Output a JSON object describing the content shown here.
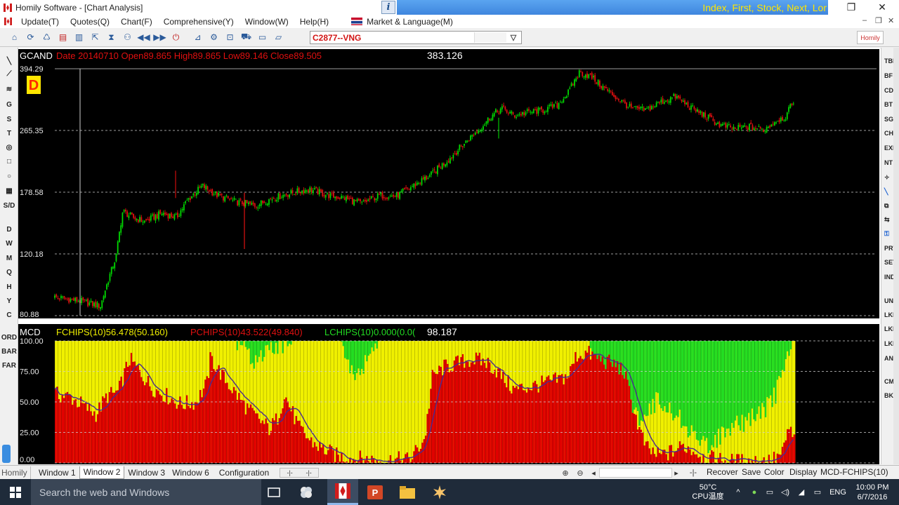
{
  "window": {
    "title": "Homily Software - [Chart Analysis]",
    "ticker_text": "Index, First, Stock, Next, Lor",
    "info_button": "i"
  },
  "menu": {
    "items": [
      "Update(T)",
      "Quotes(Q)",
      "Chart(F)",
      "Comprehensive(Y)",
      "Window(W)",
      "Help(H)"
    ],
    "market_language": "Market & Language(M)"
  },
  "toolbar": {
    "symbol": "C2877--VNG",
    "right_label": "Homily"
  },
  "left_tools": [
    "G",
    "S",
    "T",
    "S/D",
    "D",
    "W",
    "M",
    "Q",
    "H",
    "Y",
    "C",
    "ORD",
    "BAR",
    "FAR"
  ],
  "right_tools": [
    "TBF",
    "BF",
    "CD",
    "BT",
    "SGN",
    "CHN",
    "EXP",
    "NT",
    "PRT",
    "SET",
    "IND",
    "UNI",
    "LKL",
    "LKP",
    "LKM",
    "ANZ",
    "CM",
    "BK"
  ],
  "main_chart": {
    "code": "GCAND",
    "period_badge": "D",
    "info_line": "Date 20140710   Open89.865   High89.865   Low89.146   Close89.505",
    "cursor_value": "383.126"
  },
  "indicator": {
    "code": "MCD",
    "fchips": "FCHIPS(10)56.478(50.160)",
    "pchips": "PCHIPS(10)43.522(49.840)",
    "lchips": "LCHIPS(10)0.000(0.0(",
    "cursor_value": "98.187"
  },
  "chart_data": [
    {
      "type": "candlestick",
      "name": "GCAND",
      "y_ticks": [
        394.29,
        265.35,
        178.58,
        120.18,
        80.88
      ],
      "ylim": [
        80.88,
        394.29
      ],
      "log_scale": true,
      "grid": "dashed horizontal at tick levels",
      "colors": {
        "up": "#00d800",
        "down": "#e01010",
        "cursor": "#cfcfcf",
        "background": "#000000"
      },
      "close_trend": [
        [
          0.0,
          91
        ],
        [
          0.032,
          89
        ],
        [
          0.062,
          86
        ],
        [
          0.07,
          98
        ],
        [
          0.083,
          118
        ],
        [
          0.092,
          158
        ],
        [
          0.105,
          152
        ],
        [
          0.122,
          148
        ],
        [
          0.145,
          156
        ],
        [
          0.165,
          152
        ],
        [
          0.18,
          170
        ],
        [
          0.2,
          186
        ],
        [
          0.22,
          175
        ],
        [
          0.245,
          168
        ],
        [
          0.272,
          164
        ],
        [
          0.295,
          172
        ],
        [
          0.322,
          178
        ],
        [
          0.345,
          182
        ],
        [
          0.37,
          175
        ],
        [
          0.392,
          172
        ],
        [
          0.415,
          166
        ],
        [
          0.44,
          175
        ],
        [
          0.462,
          174
        ],
        [
          0.485,
          186
        ],
        [
          0.51,
          200
        ],
        [
          0.535,
          222
        ],
        [
          0.555,
          245
        ],
        [
          0.575,
          268
        ],
        [
          0.59,
          290
        ],
        [
          0.605,
          306
        ],
        [
          0.622,
          292
        ],
        [
          0.64,
          298
        ],
        [
          0.66,
          302
        ],
        [
          0.68,
          312
        ],
        [
          0.695,
          338
        ],
        [
          0.71,
          385
        ],
        [
          0.725,
          376
        ],
        [
          0.742,
          350
        ],
        [
          0.76,
          328
        ],
        [
          0.78,
          306
        ],
        [
          0.8,
          302
        ],
        [
          0.82,
          318
        ],
        [
          0.84,
          330
        ],
        [
          0.86,
          308
        ],
        [
          0.88,
          292
        ],
        [
          0.9,
          275
        ],
        [
          0.92,
          268
        ],
        [
          0.94,
          272
        ],
        [
          0.96,
          266
        ],
        [
          0.975,
          282
        ],
        [
          0.99,
          290
        ],
        [
          1.0,
          322
        ]
      ]
    },
    {
      "type": "stacked-area",
      "name": "MCD",
      "y_ticks": [
        100.0,
        75.0,
        50.0,
        25.0,
        0.0
      ],
      "ylim": [
        0,
        100
      ],
      "grid": "dashed horizontal at tick levels",
      "colors": {
        "FCHIPS": "#f0f000",
        "PCHIPS": "#e00000",
        "LCHIPS": "#22dd22",
        "average_line": "#4a2a90",
        "background": "#000000"
      },
      "series": [
        {
          "name": "PCHIPS",
          "values_trend": [
            [
              0.0,
              56
            ],
            [
              0.02,
              54
            ],
            [
              0.04,
              46
            ],
            [
              0.055,
              40
            ],
            [
              0.07,
              55
            ],
            [
              0.085,
              58
            ],
            [
              0.1,
              85
            ],
            [
              0.115,
              74
            ],
            [
              0.13,
              62
            ],
            [
              0.15,
              55
            ],
            [
              0.17,
              48
            ],
            [
              0.19,
              50
            ],
            [
              0.205,
              65
            ],
            [
              0.21,
              86
            ],
            [
              0.225,
              72
            ],
            [
              0.24,
              60
            ],
            [
              0.255,
              48
            ],
            [
              0.27,
              38
            ],
            [
              0.29,
              28
            ],
            [
              0.3,
              36
            ],
            [
              0.31,
              56
            ],
            [
              0.33,
              28
            ],
            [
              0.345,
              18
            ],
            [
              0.36,
              12
            ],
            [
              0.38,
              6
            ],
            [
              0.4,
              4
            ],
            [
              0.44,
              2
            ],
            [
              0.48,
              3
            ],
            [
              0.5,
              20
            ],
            [
              0.51,
              70
            ],
            [
              0.525,
              78
            ],
            [
              0.545,
              82
            ],
            [
              0.565,
              85
            ],
            [
              0.585,
              82
            ],
            [
              0.6,
              74
            ],
            [
              0.62,
              60
            ],
            [
              0.64,
              62
            ],
            [
              0.66,
              65
            ],
            [
              0.68,
              68
            ],
            [
              0.695,
              72
            ],
            [
              0.705,
              88
            ],
            [
              0.72,
              90
            ],
            [
              0.74,
              84
            ],
            [
              0.76,
              80
            ],
            [
              0.77,
              74
            ],
            [
              0.78,
              50
            ],
            [
              0.79,
              28
            ],
            [
              0.8,
              12
            ],
            [
              0.815,
              6
            ],
            [
              0.83,
              8
            ],
            [
              0.85,
              14
            ],
            [
              0.865,
              10
            ],
            [
              0.88,
              4
            ],
            [
              0.92,
              1
            ],
            [
              0.97,
              2
            ],
            [
              0.985,
              8
            ],
            [
              0.993,
              30
            ],
            [
              1.0,
              18
            ]
          ]
        },
        {
          "name": "LCHIPS",
          "values_trend": [
            [
              0.0,
              0
            ],
            [
              0.245,
              0
            ],
            [
              0.255,
              6
            ],
            [
              0.27,
              16
            ],
            [
              0.285,
              10
            ],
            [
              0.3,
              4
            ],
            [
              0.32,
              0
            ],
            [
              0.385,
              0
            ],
            [
              0.395,
              14
            ],
            [
              0.405,
              34
            ],
            [
              0.415,
              22
            ],
            [
              0.425,
              8
            ],
            [
              0.44,
              0
            ],
            [
              0.72,
              0
            ],
            [
              0.73,
              26
            ],
            [
              0.745,
              38
            ],
            [
              0.76,
              44
            ],
            [
              0.775,
              52
            ],
            [
              0.79,
              62
            ],
            [
              0.805,
              56
            ],
            [
              0.815,
              48
            ],
            [
              0.83,
              56
            ],
            [
              0.85,
              66
            ],
            [
              0.86,
              74
            ],
            [
              0.875,
              86
            ],
            [
              0.885,
              84
            ],
            [
              0.9,
              78
            ],
            [
              0.92,
              70
            ],
            [
              0.94,
              64
            ],
            [
              0.96,
              56
            ],
            [
              0.975,
              44
            ],
            [
              0.985,
              22
            ],
            [
              0.993,
              8
            ],
            [
              1.0,
              0
            ]
          ]
        },
        {
          "name": "FCHIPS",
          "note": "remainder to 100"
        }
      ]
    }
  ],
  "tabs": {
    "first": "Homily",
    "items": [
      "Window 1",
      "Window 2",
      "Window 3",
      "Window 6",
      "Configuration"
    ],
    "active": "Window 2",
    "right_buttons": [
      "Recover",
      "Save",
      "Color",
      "Display"
    ],
    "status": "MCD-FCHIPS(10)"
  },
  "taskbar": {
    "search_placeholder": "Search the web and Windows",
    "cpu_temp": "50°C",
    "cpu_label": "CPU温度",
    "language": "ENG",
    "time": "10:00 PM",
    "date": "6/7/2016"
  }
}
